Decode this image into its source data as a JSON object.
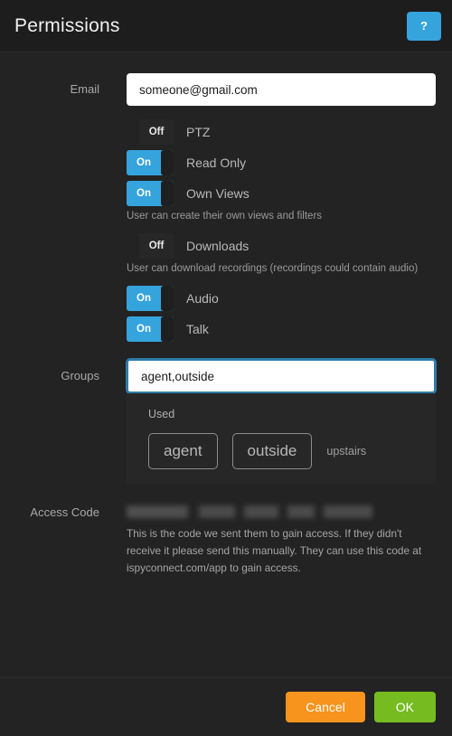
{
  "header": {
    "title": "Permissions",
    "help_label": "?",
    "help_color": "#35a3dc"
  },
  "email": {
    "label": "Email",
    "value": "someone@gmail.com",
    "placeholder": "Email"
  },
  "permissions": [
    {
      "name": "ptz",
      "label": "PTZ",
      "state": "Off",
      "hint": ""
    },
    {
      "name": "read-only",
      "label": "Read Only",
      "state": "On",
      "hint": ""
    },
    {
      "name": "own-views",
      "label": "Own Views",
      "state": "On",
      "hint": "User can create their own views and filters"
    },
    {
      "name": "downloads",
      "label": "Downloads",
      "state": "Off",
      "hint": "User can download recordings (recordings could contain audio)"
    },
    {
      "name": "audio",
      "label": "Audio",
      "state": "On",
      "hint": ""
    },
    {
      "name": "talk",
      "label": "Talk",
      "state": "On",
      "hint": ""
    }
  ],
  "toggle_states": {
    "on": "On",
    "off": "Off"
  },
  "groups": {
    "label": "Groups",
    "value": "agent,outside",
    "placeholder": "Groups",
    "used_title": "Used",
    "tags": [
      {
        "label": "agent",
        "selected": true
      },
      {
        "label": "outside",
        "selected": true
      },
      {
        "label": "upstairs",
        "selected": false
      }
    ]
  },
  "access_code": {
    "label": "Access Code",
    "value": "",
    "redacted": true,
    "hint": "This is the code we sent them to gain access. If they didn't receive it please send this manually. They can use this code at ispyconnect.com/app to gain access."
  },
  "footer": {
    "cancel_label": "Cancel",
    "ok_label": "OK",
    "cancel_color": "#f7941e",
    "ok_color": "#76bc21"
  }
}
